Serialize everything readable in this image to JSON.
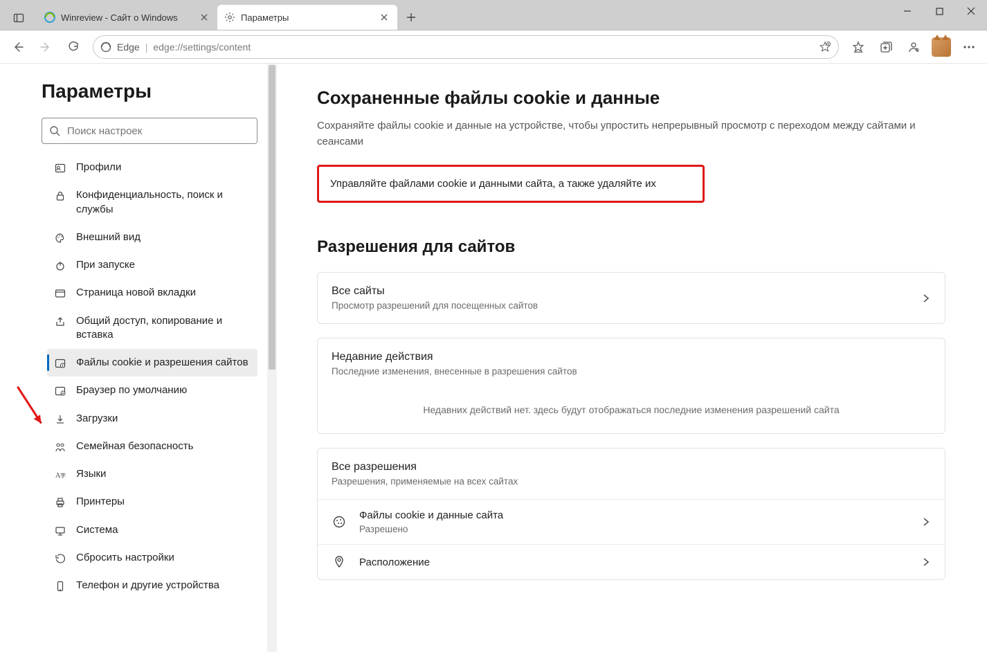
{
  "tabs": [
    {
      "title": "Winreview - Сайт о Windows",
      "active": false
    },
    {
      "title": "Параметры",
      "active": true
    }
  ],
  "address": {
    "protocol_label": "Edge",
    "url": "edge://settings/content"
  },
  "sidebar": {
    "title": "Параметры",
    "search_placeholder": "Поиск настроек",
    "items": [
      {
        "label": "Профили"
      },
      {
        "label": "Конфиденциальность, поиск и службы"
      },
      {
        "label": "Внешний вид"
      },
      {
        "label": "При запуске"
      },
      {
        "label": "Страница новой вкладки"
      },
      {
        "label": "Общий доступ, копирование и вставка"
      },
      {
        "label": "Файлы cookie и разрешения сайтов"
      },
      {
        "label": "Браузер по умолчанию"
      },
      {
        "label": "Загрузки"
      },
      {
        "label": "Семейная безопасность"
      },
      {
        "label": "Языки"
      },
      {
        "label": "Принтеры"
      },
      {
        "label": "Система"
      },
      {
        "label": "Сбросить настройки"
      },
      {
        "label": "Телефон и другие устройства"
      }
    ],
    "selected_index": 6
  },
  "content": {
    "cookies": {
      "title": "Сохраненные файлы cookie и данные",
      "subtitle": "Сохраняйте файлы cookie и данные на устройстве, чтобы упростить непрерывный просмотр с переходом между сайтами и сеансами",
      "manage_label": "Управляйте файлами cookie и данными сайта, а также удаляйте их"
    },
    "permissions": {
      "title": "Разрешения для сайтов",
      "all_sites": {
        "title": "Все сайты",
        "desc": "Просмотр разрешений для посещенных сайтов"
      },
      "recent": {
        "title": "Недавние действия",
        "desc": "Последние изменения, внесенные в разрешения сайтов",
        "empty": "Недавних действий нет. здесь будут отображаться последние изменения разрешений сайта"
      },
      "all_perms": {
        "title": "Все разрешения",
        "desc": "Разрешения, применяемые на всех сайтах"
      },
      "rows": [
        {
          "title": "Файлы cookie и данные сайта",
          "desc": "Разрешено"
        },
        {
          "title": "Расположение",
          "desc": ""
        }
      ]
    }
  }
}
